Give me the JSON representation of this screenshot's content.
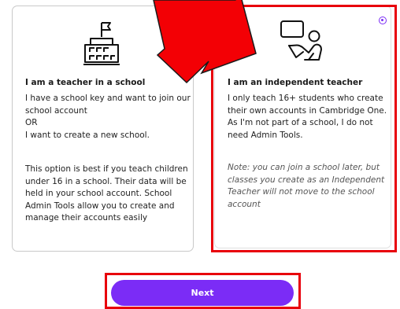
{
  "school_option": {
    "icon": "school-building-icon",
    "title": "I am a teacher in a school",
    "line1": "I have a school key and want to join our school account",
    "or": "OR",
    "line2": "I want to create a new school.",
    "description": "This option is best if you teach children under 16 in a school. Their data will be held in your school account. School Admin Tools allow you to create and manage their accounts easily"
  },
  "independent_option": {
    "icon": "teacher-at-board-icon",
    "selected": true,
    "title": "I am an independent teacher",
    "description": "I only teach 16+ students who create their own accounts in Cambridge One. As I'm not part of a school, I do not need Admin Tools.",
    "note": "Note: you can join a school later, but classes you create as an Independent Teacher will not move to the school account"
  },
  "next_button": {
    "label": "Next"
  },
  "colors": {
    "accent": "#7b2cf6",
    "annotation": "#e8000b",
    "card_border": "#c9c9c9"
  }
}
